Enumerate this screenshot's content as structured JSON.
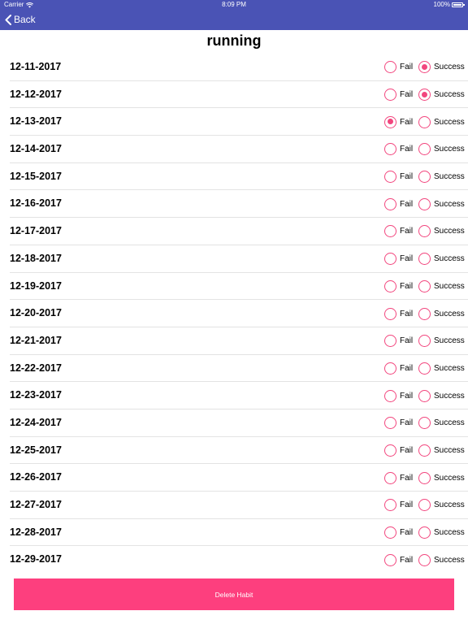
{
  "status_bar": {
    "carrier": "Carrier",
    "time": "8:09 PM",
    "battery": "100%"
  },
  "nav": {
    "back_label": "Back"
  },
  "title": "running",
  "options": {
    "fail_label": "Fail",
    "success_label": "Success"
  },
  "entries": [
    {
      "date": "12-11-2017",
      "selected": "success"
    },
    {
      "date": "12-12-2017",
      "selected": "success"
    },
    {
      "date": "12-13-2017",
      "selected": "fail"
    },
    {
      "date": "12-14-2017",
      "selected": "none"
    },
    {
      "date": "12-15-2017",
      "selected": "none"
    },
    {
      "date": "12-16-2017",
      "selected": "none"
    },
    {
      "date": "12-17-2017",
      "selected": "none"
    },
    {
      "date": "12-18-2017",
      "selected": "none"
    },
    {
      "date": "12-19-2017",
      "selected": "none"
    },
    {
      "date": "12-20-2017",
      "selected": "none"
    },
    {
      "date": "12-21-2017",
      "selected": "none"
    },
    {
      "date": "12-22-2017",
      "selected": "none"
    },
    {
      "date": "12-23-2017",
      "selected": "none"
    },
    {
      "date": "12-24-2017",
      "selected": "none"
    },
    {
      "date": "12-25-2017",
      "selected": "none"
    },
    {
      "date": "12-26-2017",
      "selected": "none"
    },
    {
      "date": "12-27-2017",
      "selected": "none"
    },
    {
      "date": "12-28-2017",
      "selected": "none"
    },
    {
      "date": "12-29-2017",
      "selected": "none"
    }
  ],
  "delete_button_label": "Delete Habit",
  "colors": {
    "nav_background": "#4a53b5",
    "accent": "#f2467e",
    "delete_button": "#fd3f7e"
  }
}
